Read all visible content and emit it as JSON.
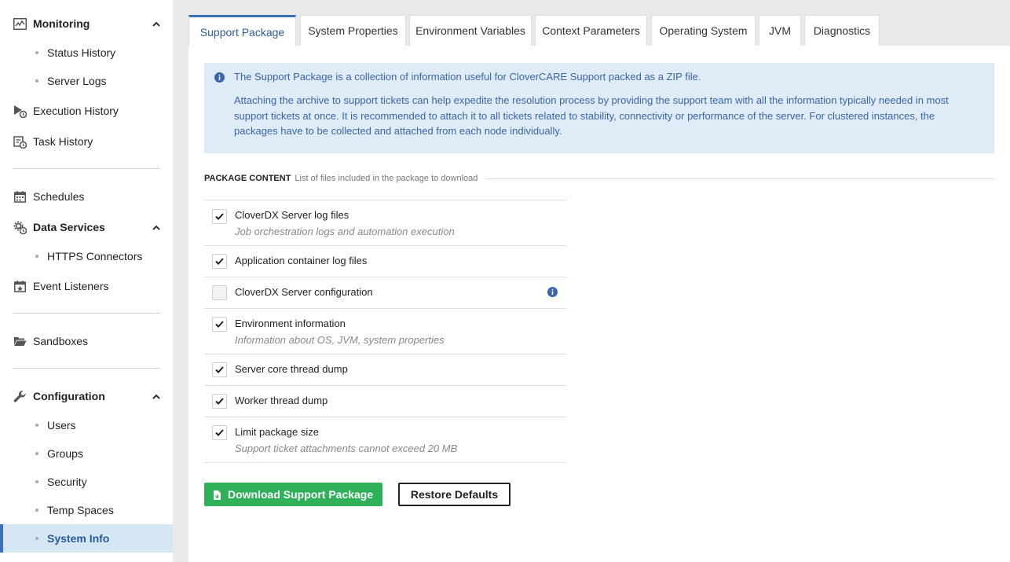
{
  "sidebar": {
    "monitoring": {
      "label": "Monitoring",
      "icon": "monitoring-icon"
    },
    "status_history": {
      "label": "Status History"
    },
    "server_logs": {
      "label": "Server Logs"
    },
    "execution_history": {
      "label": "Execution History",
      "icon": "execution-history-icon"
    },
    "task_history": {
      "label": "Task History",
      "icon": "task-history-icon"
    },
    "schedules": {
      "label": "Schedules",
      "icon": "calendar-icon"
    },
    "data_services": {
      "label": "Data Services",
      "icon": "data-services-icon"
    },
    "https_connectors": {
      "label": "HTTPS Connectors"
    },
    "event_listeners": {
      "label": "Event Listeners",
      "icon": "event-listeners-icon"
    },
    "sandboxes": {
      "label": "Sandboxes",
      "icon": "folder-icon"
    },
    "configuration": {
      "label": "Configuration",
      "icon": "wrench-icon"
    },
    "users": {
      "label": "Users"
    },
    "groups": {
      "label": "Groups"
    },
    "security": {
      "label": "Security"
    },
    "temp_spaces": {
      "label": "Temp Spaces"
    },
    "system_info": {
      "label": "System Info",
      "active": true
    }
  },
  "tabs": [
    {
      "label": "Support Package",
      "active": true
    },
    {
      "label": "System Properties"
    },
    {
      "label": "Environment Variables"
    },
    {
      "label": "Context Parameters"
    },
    {
      "label": "Operating System"
    },
    {
      "label": "JVM"
    },
    {
      "label": "Diagnostics"
    }
  ],
  "info": {
    "line1": "The Support Package is a collection of information useful for CloverCARE Support packed as a ZIP file.",
    "line2": "Attaching the archive to support tickets can help expedite the resolution process by providing the support team with all the information typically needed in most support tickets at once. It is recommended to attach it to all tickets related to stability, connectivity or performance of the server. For clustered instances, the packages have to be collected and attached from each node individually."
  },
  "package_content": {
    "title": "PACKAGE CONTENT",
    "description": "List of files included in the package to download",
    "items": [
      {
        "label": "CloverDX Server log files",
        "description": "Job orchestration logs and automation execution",
        "checked": true
      },
      {
        "label": "Application container log files",
        "checked": true
      },
      {
        "label": "CloverDX Server configuration",
        "checked": false,
        "info_icon": "info-icon"
      },
      {
        "label": "Environment information",
        "description": "Information about OS, JVM, system properties",
        "checked": true
      },
      {
        "label": "Server core thread dump",
        "checked": true
      },
      {
        "label": "Worker thread dump",
        "checked": true
      },
      {
        "label": "Limit package size",
        "description": "Support ticket attachments cannot exceed 20 MB",
        "checked": true
      }
    ]
  },
  "buttons": {
    "download": "Download Support Package",
    "restore": "Restore Defaults"
  },
  "colors": {
    "accent": "#3d6fb4",
    "info_bg": "#dfebf6",
    "info_text": "#3a66a8",
    "primary_button": "#2fb15a",
    "active_nav_bg": "#d6e7f4"
  }
}
